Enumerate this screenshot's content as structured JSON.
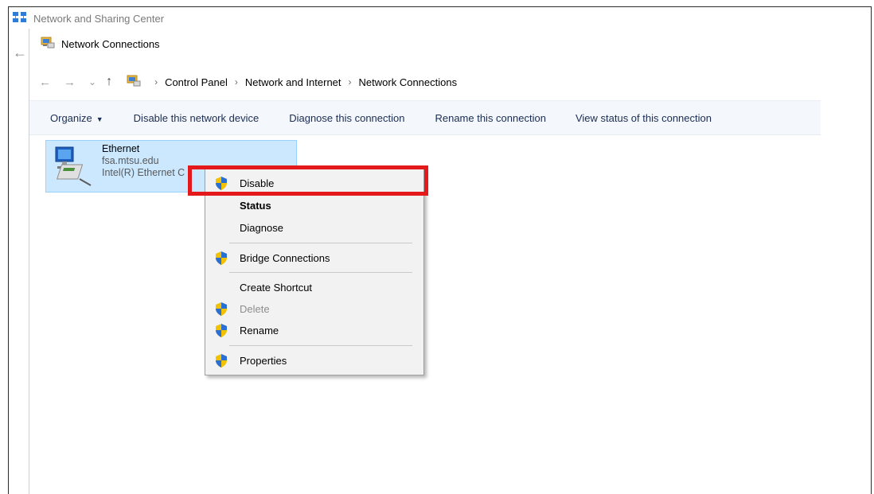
{
  "background_window": {
    "title": "Network and Sharing Center"
  },
  "window": {
    "title": "Network Connections"
  },
  "breadcrumb": [
    "Control Panel",
    "Network and Internet",
    "Network Connections"
  ],
  "nav": {
    "back": "←",
    "forward": "→",
    "recent": "⌄",
    "up": "↑",
    "separator": "›"
  },
  "toolbar": {
    "organize": "Organize",
    "organize_caret": "▼",
    "disable": "Disable this network device",
    "diagnose": "Diagnose this connection",
    "rename": "Rename this connection",
    "view_status": "View status of this connection"
  },
  "connection": {
    "name": "Ethernet",
    "domain": "fsa.mtsu.edu",
    "adapter": "Intel(R) Ethernet C"
  },
  "context_menu": {
    "disable": "Disable",
    "status": "Status",
    "diagnose": "Diagnose",
    "bridge": "Bridge Connections",
    "shortcut": "Create Shortcut",
    "delete": "Delete",
    "rename": "Rename",
    "properties": "Properties"
  },
  "colors": {
    "highlight_box": "#e3191b",
    "selection": "#cce8ff",
    "toolbar_bg": "#f4f7fb",
    "menu_bg": "#f2f2f2"
  },
  "icons": [
    "network-center-icon",
    "network-connections-icon",
    "ethernet-adapter-icon",
    "uac-shield-icon"
  ]
}
